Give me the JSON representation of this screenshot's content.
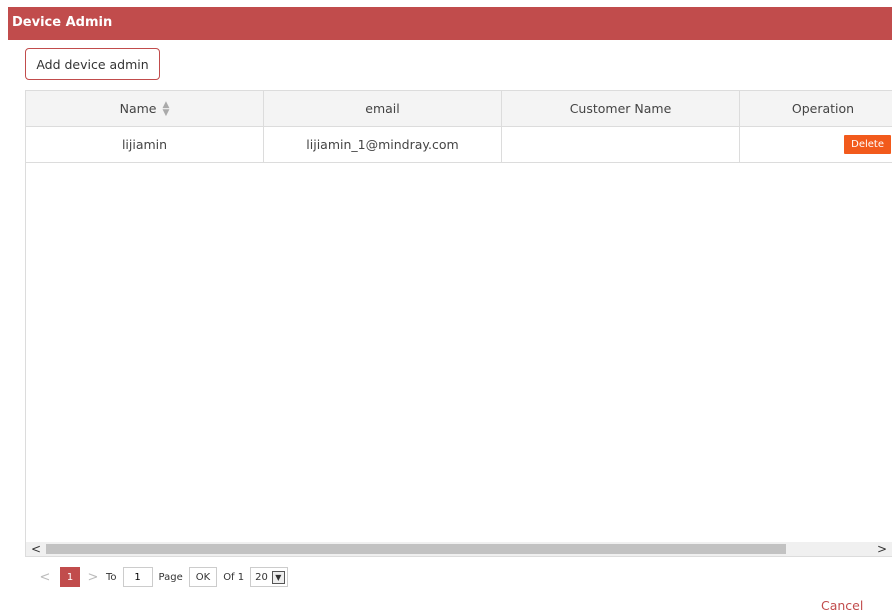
{
  "header": {
    "title": "Device Admin"
  },
  "toolbar": {
    "add_label": "Add device admin"
  },
  "table": {
    "columns": [
      "Name",
      "email",
      "Customer Name",
      "Operation"
    ],
    "rows": [
      {
        "name": "lijiamin",
        "email": "lijiamin_1@mindray.com",
        "customer_name": "",
        "operation": "Delete"
      }
    ]
  },
  "pagination": {
    "prev": "<",
    "current_page": "1",
    "next": ">",
    "to_label": "To",
    "goto_value": "1",
    "page_label": "Page",
    "ok_label": "OK",
    "of_label": "Of 1",
    "page_size": "20"
  },
  "footer": {
    "cancel_label": "Cancel"
  },
  "colors": {
    "brand": "#c14c4c",
    "delete": "#f25a1c"
  },
  "scrollbar": {
    "left_arrow": "<",
    "right_arrow": ">"
  }
}
